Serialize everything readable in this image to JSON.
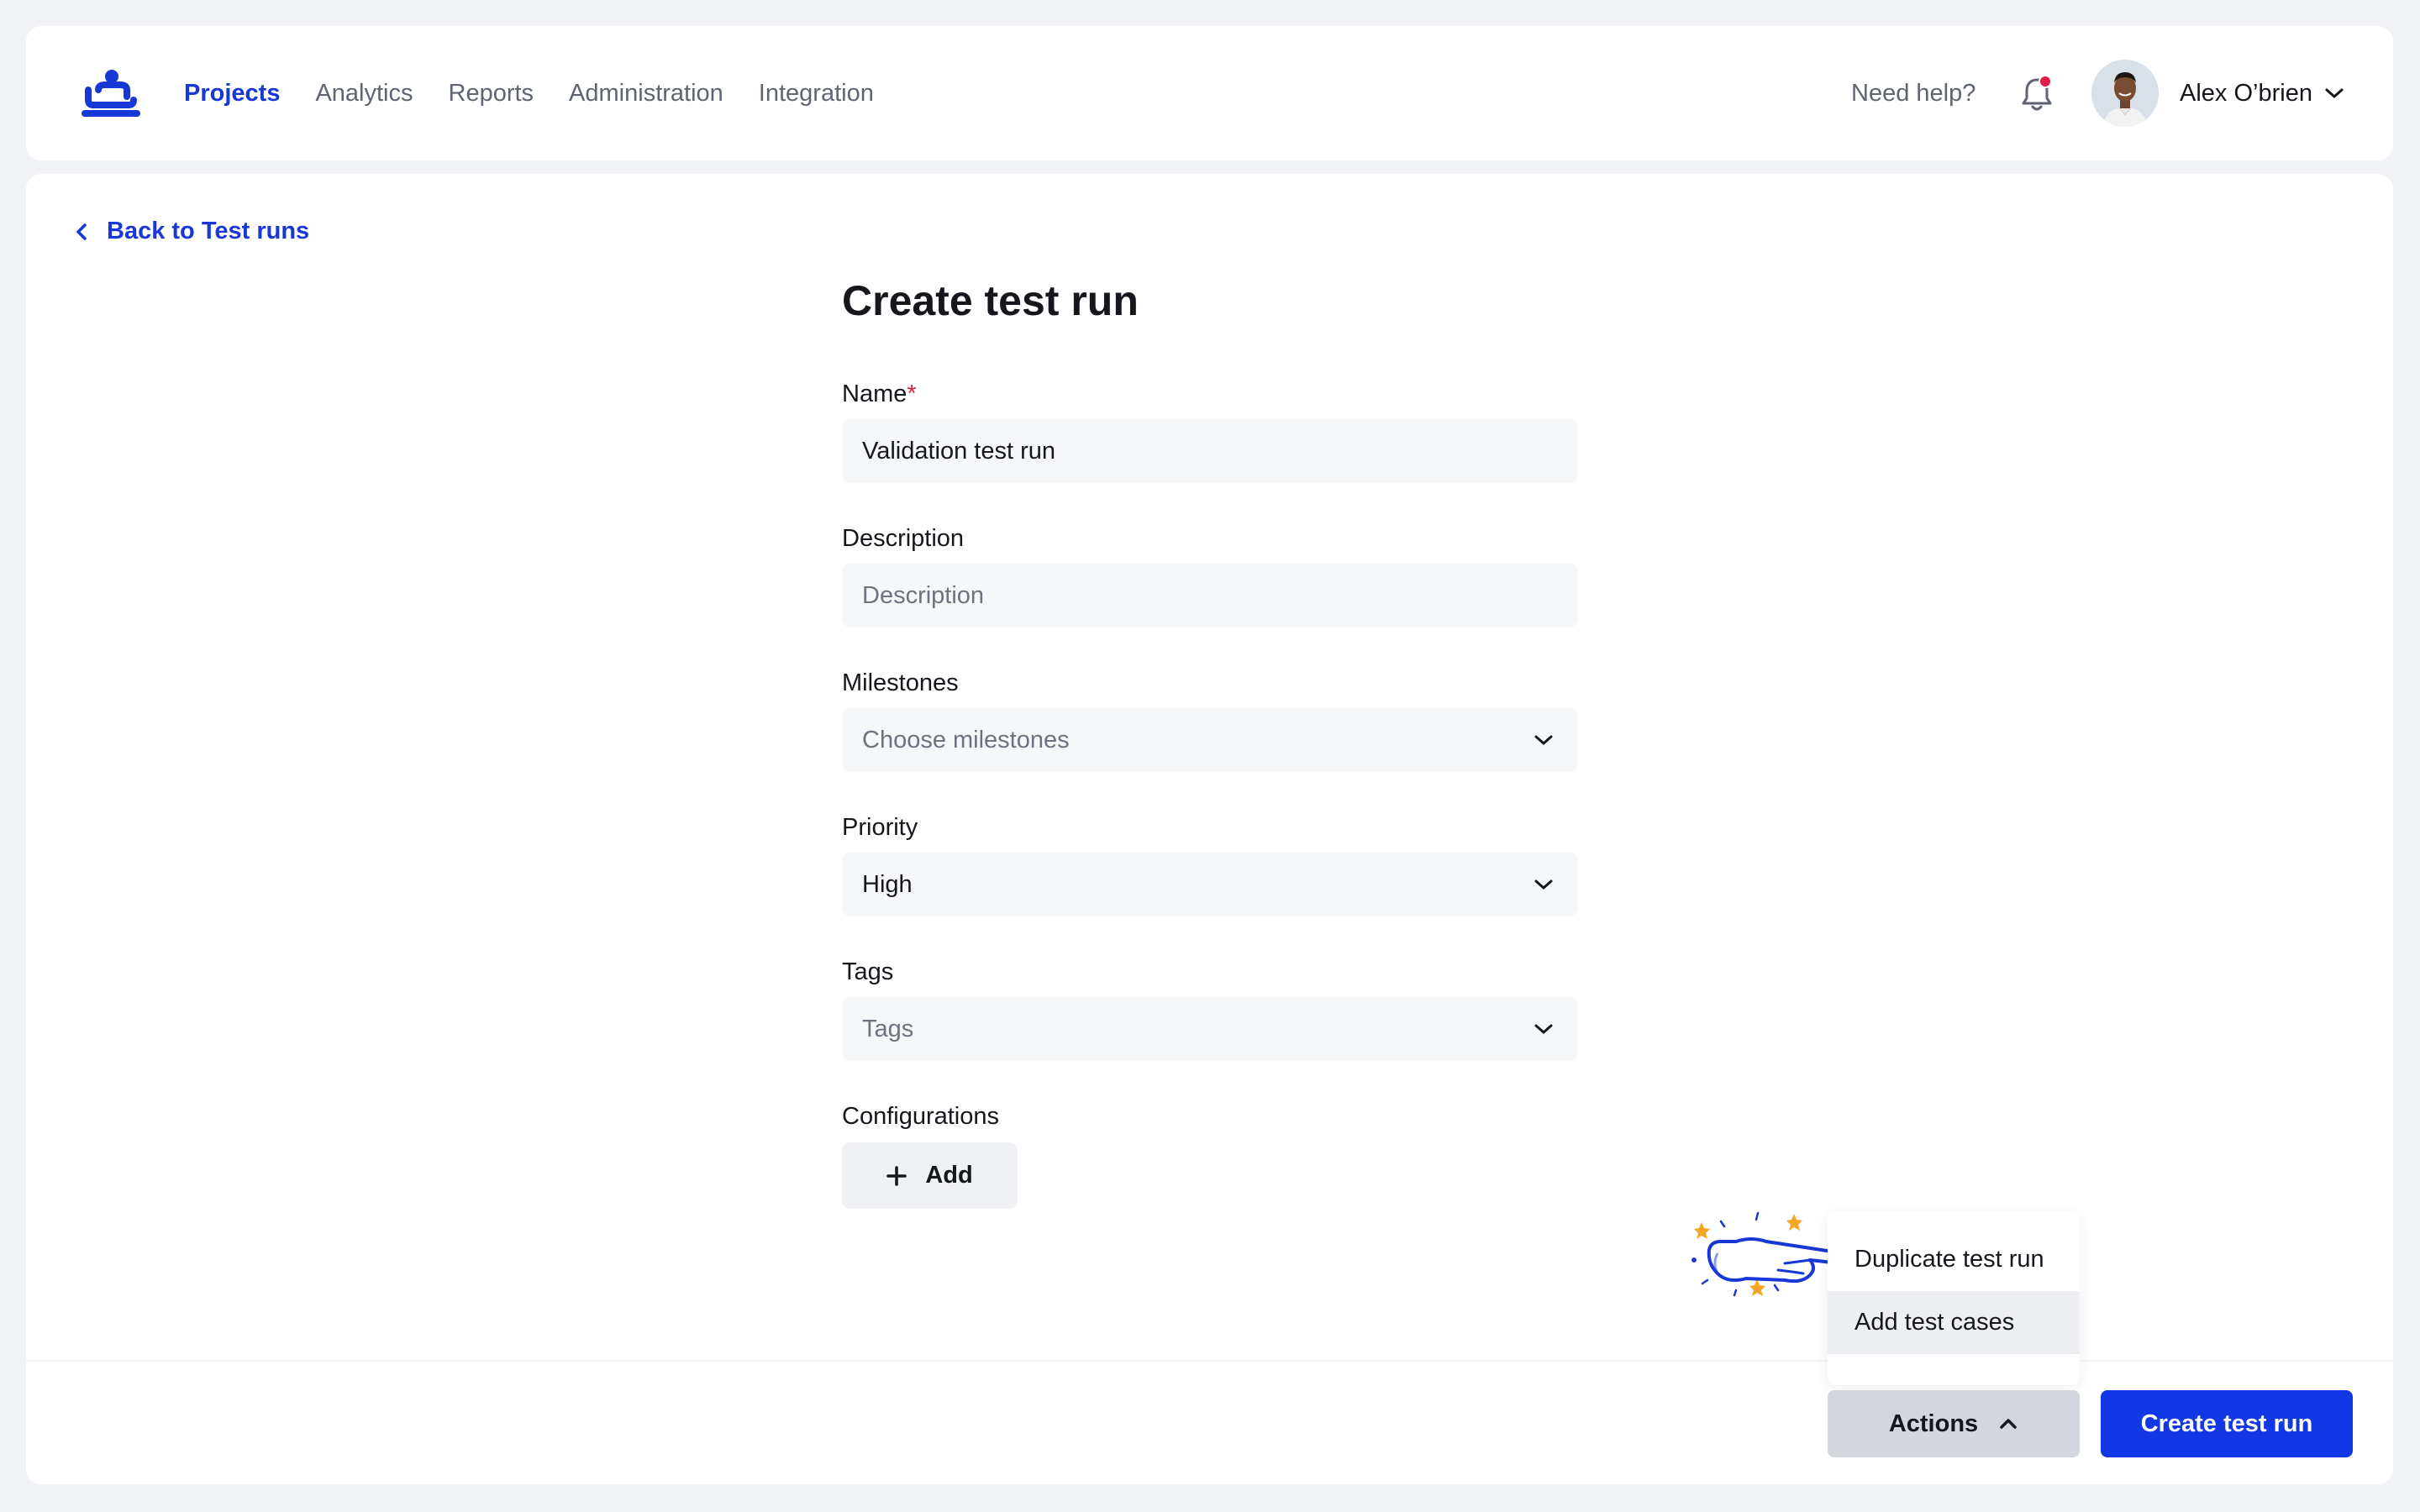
{
  "header": {
    "nav": [
      "Projects",
      "Analytics",
      "Reports",
      "Administration",
      "Integration"
    ],
    "active_nav": "Projects",
    "help_label": "Need help?",
    "user_name": "Alex O’brien"
  },
  "page": {
    "back_label": "Back to Test runs",
    "title": "Create test run"
  },
  "form": {
    "name": {
      "label": "Name",
      "required_mark": "*",
      "value": "Validation test run"
    },
    "description": {
      "label": "Description",
      "placeholder": "Description"
    },
    "milestones": {
      "label": "Milestones",
      "placeholder": "Choose milestones"
    },
    "priority": {
      "label": "Priority",
      "value": "High"
    },
    "tags": {
      "label": "Tags",
      "placeholder": "Tags"
    },
    "configurations": {
      "label": "Configurations",
      "add_label": "Add"
    }
  },
  "actions_menu": {
    "items": [
      "Duplicate test run",
      "Add test cases"
    ],
    "hovered_item": "Add test cases"
  },
  "footer": {
    "actions_label": "Actions",
    "create_label": "Create test run"
  },
  "colors": {
    "accent": "#1237E4",
    "required": "#E11D48",
    "notification_dot": "#E11D48"
  }
}
